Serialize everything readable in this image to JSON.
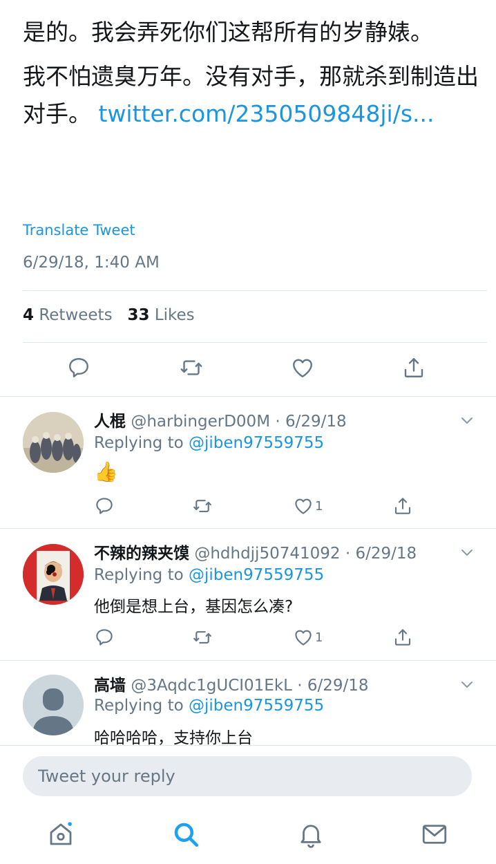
{
  "tweet": {
    "line1": "是的。我会弄死你们这帮所有的岁静婊。",
    "line2_text": "我不怕遗臭万年。没有对手，那就杀到制造出对手。 ",
    "line2_link": "twitter.com/2350509848ji/s...",
    "translate_label": "Translate Tweet",
    "timestamp": "6/29/18, 1:40 AM",
    "retweets_count": "4",
    "retweets_label": "Retweets",
    "likes_count": "33",
    "likes_label": "Likes"
  },
  "replies": [
    {
      "name": "人棍",
      "handle_meta": "@harbingerD00M · 6/29/18",
      "replying_prefix": "Replying to ",
      "replying_handle": "@jiben97559755",
      "text": "👍",
      "like_count": "1"
    },
    {
      "name": "不辣的辣夹馍",
      "handle_meta": "@hdhdjj50741092 · 6/29/18",
      "replying_prefix": "Replying to ",
      "replying_handle": "@jiben97559755",
      "text": "他倒是想上台，基因怎么凑?",
      "like_count": "1"
    },
    {
      "name": "高墙",
      "handle_meta": "@3Aqdc1gUCI01EkL · 6/29/18",
      "replying_prefix": "Replying to ",
      "replying_handle": "@jiben97559755",
      "text": "哈哈哈哈，支持你上台"
    }
  ],
  "compose": {
    "placeholder": "Tweet your reply"
  },
  "icons": {
    "reply": "reply-icon",
    "retweet": "retweet-icon",
    "like": "heart-icon",
    "share": "share-icon",
    "chevron": "chevron-down-icon",
    "home": "home-icon",
    "search": "search-icon",
    "notifications": "bell-icon",
    "messages": "mail-icon"
  },
  "colors": {
    "link": "#1b95e0",
    "muted": "#657786",
    "text": "#14171a",
    "divider": "#e1e8ed",
    "active_tab": "#1da1f2"
  }
}
